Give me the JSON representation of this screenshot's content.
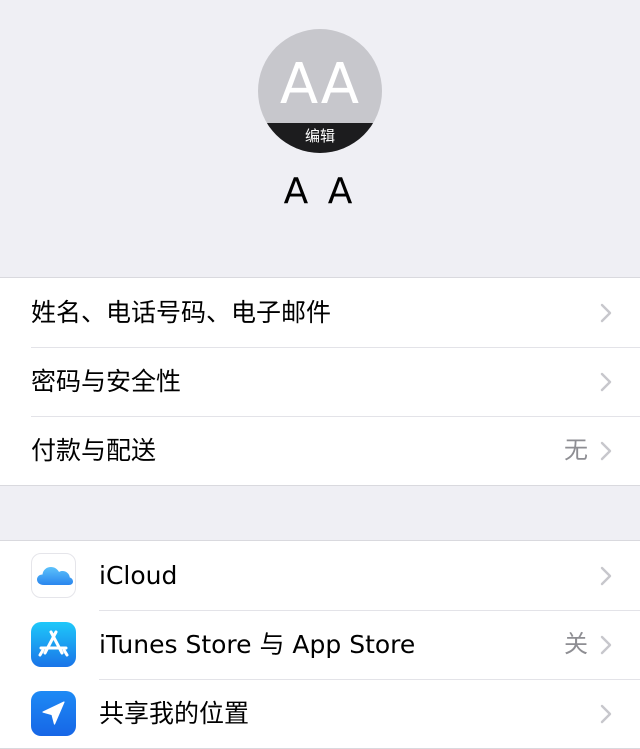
{
  "profile": {
    "initials": "AA",
    "edit_label": "编辑",
    "name": "A A"
  },
  "account_section": {
    "items": [
      {
        "label": "姓名、电话号码、电子邮件",
        "value": ""
      },
      {
        "label": "密码与安全性",
        "value": ""
      },
      {
        "label": "付款与配送",
        "value": "无"
      }
    ]
  },
  "services_section": {
    "items": [
      {
        "label": "iCloud",
        "value": "",
        "icon": "icloud-icon"
      },
      {
        "label": "iTunes Store 与 App Store",
        "value": "关",
        "icon": "app-store-icon"
      },
      {
        "label": "共享我的位置",
        "value": "",
        "icon": "location-arrow-icon"
      }
    ]
  },
  "colors": {
    "background": "#efeff4",
    "cell": "#ffffff",
    "secondary_text": "#8e8e93",
    "chevron": "#c7c7cc",
    "app_store_blue": "#1a74e8",
    "icloud_blue": "#3aa0f3"
  }
}
